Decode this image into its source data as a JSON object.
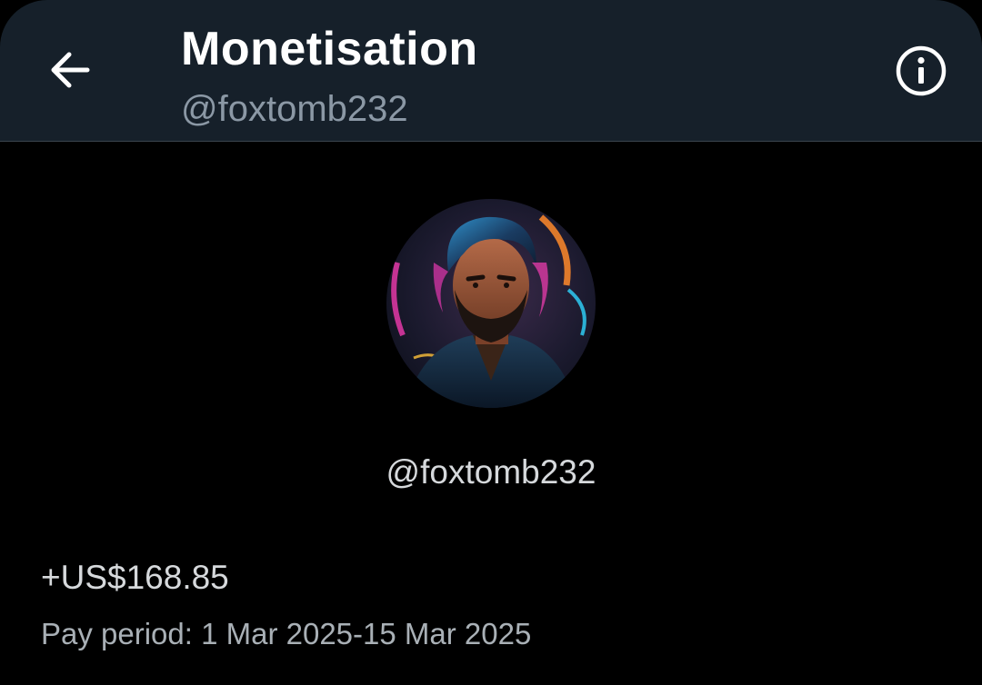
{
  "header": {
    "back_icon": "arrow-left-icon",
    "title": "Monetisation",
    "subtitle": "@foxtomb232",
    "info_icon": "info-circle-icon"
  },
  "profile": {
    "avatar": "avatar-image",
    "handle": "@foxtomb232"
  },
  "earnings": {
    "amount": "+US$168.85",
    "pay_period": "Pay period: 1 Mar 2025-15 Mar 2025"
  },
  "colors": {
    "background": "#000000",
    "header_background": "#16202a",
    "title": "#ffffff",
    "muted_text": "#8b98a5",
    "body_text": "#d6d9dc"
  }
}
